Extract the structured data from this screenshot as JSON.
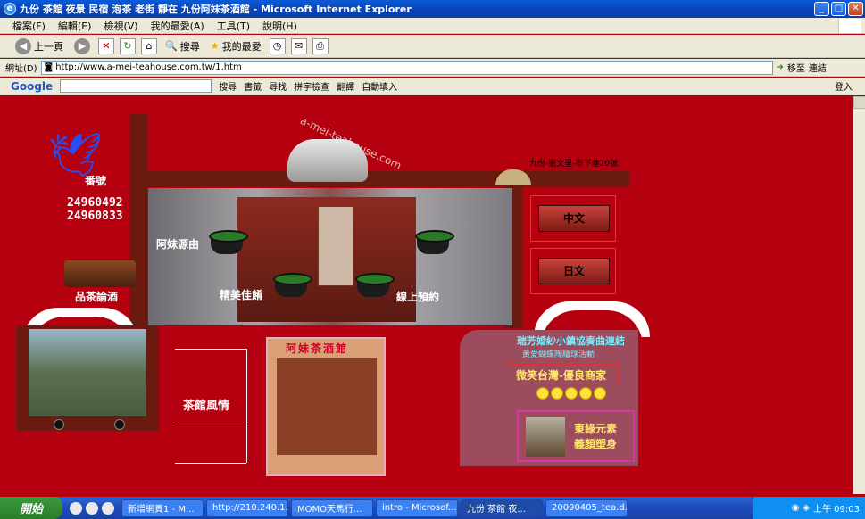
{
  "window": {
    "title": "九份 茶館 夜景 民宿 泡茶 老街 靜在 九份阿妹茶酒館 - Microsoft Internet Explorer",
    "min": "_",
    "max": "□",
    "close": "✕"
  },
  "menu": [
    "檔案(F)",
    "編輯(E)",
    "檢視(V)",
    "我的最愛(A)",
    "工具(T)",
    "說明(H)"
  ],
  "toolbar": {
    "back": "上一頁",
    "search": "搜尋",
    "favorites": "我的最愛"
  },
  "address": {
    "label": "網址(D)",
    "url": "http://www.a-mei-teahouse.com.tw/1.htm",
    "go": "移至",
    "links": "連結"
  },
  "google": {
    "brand": "Google",
    "search": "搜尋",
    "bookmarks": "書籤",
    "find": "尋找",
    "spell": "拼字檢查",
    "translate": "翻譯",
    "autofill": "自動填入",
    "login": "登入"
  },
  "site": {
    "logo_text": "a-mei-teahouse.com",
    "number_label": "番號",
    "phone1": "24960492",
    "phone2": "24960833",
    "address_note": "九份-崇文里-市下巷20號",
    "nav_left": "阿妹源由",
    "nav_mid": "精美佳餚",
    "nav_right": "線上預約",
    "pin_cha": "品茶論酒",
    "lang_cn": "中文",
    "lang_jp": "日文",
    "teahouse_style": "茶館風情",
    "sketch_title": "阿妹茶酒館",
    "promo_line1": "瑞芳婚紗小鎮協奏曲連結",
    "promo_line2": "黃愛蝴蝶陶繪球活動",
    "smile_taiwan": "微笑台灣-優良商家",
    "green_element1": "東綠元素",
    "green_element2": "義顏塑身"
  },
  "taskbar": {
    "start": "開始",
    "tasks": [
      "新增網頁1 - M...",
      "http://210.240.1...",
      "MOMO天馬行...",
      "intro - Microsof...",
      "九份 茶館 夜...",
      "20090405_tea.d..."
    ],
    "clock": "上午 09:03"
  }
}
